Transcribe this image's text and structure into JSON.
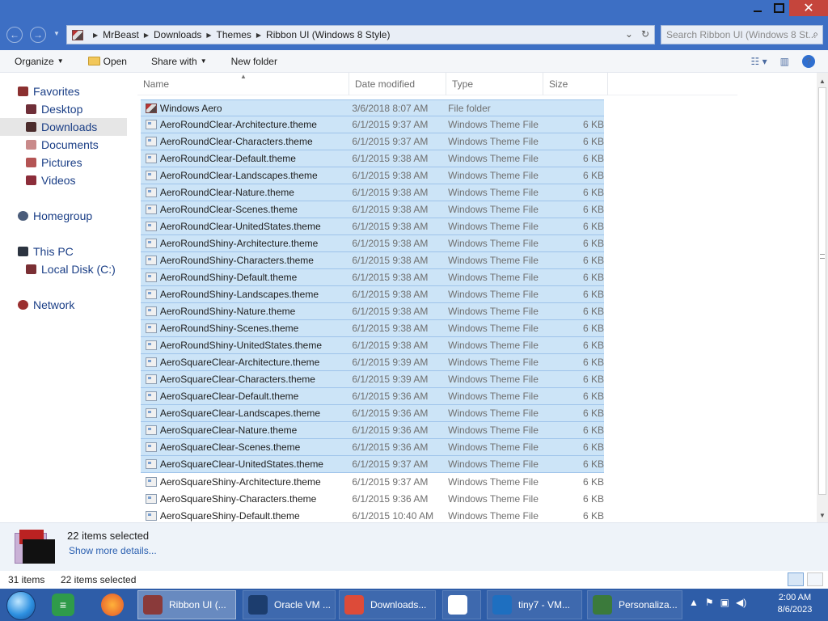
{
  "window": {
    "title_buttons": {
      "minimize": "–",
      "maximize": "❐",
      "close": "✕"
    }
  },
  "address": {
    "crumbs": [
      "MrBeast",
      "Downloads",
      "Themes",
      "Ribbon UI (Windows 8 Style)"
    ],
    "search_placeholder": "Search Ribbon UI (Windows 8 St..."
  },
  "toolbar": {
    "organize": "Organize",
    "open": "Open",
    "share_with": "Share with",
    "new_folder": "New folder",
    "help": "?"
  },
  "nav": {
    "favorites": "Favorites",
    "desktop": "Desktop",
    "downloads": "Downloads",
    "documents": "Documents",
    "pictures": "Pictures",
    "videos": "Videos",
    "homegroup": "Homegroup",
    "this_pc": "This PC",
    "local_disk": "Local Disk (C:)",
    "network": "Network"
  },
  "columns": {
    "name": "Name",
    "date": "Date modified",
    "type": "Type",
    "size": "Size"
  },
  "files": [
    {
      "name": "Windows Aero",
      "date": "3/6/2018 8:07 AM",
      "type": "File folder",
      "size": "",
      "folder": true,
      "selected": true
    },
    {
      "name": "AeroRoundClear-Architecture.theme",
      "date": "6/1/2015 9:37 AM",
      "type": "Windows Theme File",
      "size": "6 KB",
      "selected": true
    },
    {
      "name": "AeroRoundClear-Characters.theme",
      "date": "6/1/2015 9:37 AM",
      "type": "Windows Theme File",
      "size": "6 KB",
      "selected": true
    },
    {
      "name": "AeroRoundClear-Default.theme",
      "date": "6/1/2015 9:38 AM",
      "type": "Windows Theme File",
      "size": "6 KB",
      "selected": true
    },
    {
      "name": "AeroRoundClear-Landscapes.theme",
      "date": "6/1/2015 9:38 AM",
      "type": "Windows Theme File",
      "size": "6 KB",
      "selected": true
    },
    {
      "name": "AeroRoundClear-Nature.theme",
      "date": "6/1/2015 9:38 AM",
      "type": "Windows Theme File",
      "size": "6 KB",
      "selected": true
    },
    {
      "name": "AeroRoundClear-Scenes.theme",
      "date": "6/1/2015 9:38 AM",
      "type": "Windows Theme File",
      "size": "6 KB",
      "selected": true
    },
    {
      "name": "AeroRoundClear-UnitedStates.theme",
      "date": "6/1/2015 9:38 AM",
      "type": "Windows Theme File",
      "size": "6 KB",
      "selected": true
    },
    {
      "name": "AeroRoundShiny-Architecture.theme",
      "date": "6/1/2015 9:38 AM",
      "type": "Windows Theme File",
      "size": "6 KB",
      "selected": true
    },
    {
      "name": "AeroRoundShiny-Characters.theme",
      "date": "6/1/2015 9:38 AM",
      "type": "Windows Theme File",
      "size": "6 KB",
      "selected": true
    },
    {
      "name": "AeroRoundShiny-Default.theme",
      "date": "6/1/2015 9:38 AM",
      "type": "Windows Theme File",
      "size": "6 KB",
      "selected": true
    },
    {
      "name": "AeroRoundShiny-Landscapes.theme",
      "date": "6/1/2015 9:38 AM",
      "type": "Windows Theme File",
      "size": "6 KB",
      "selected": true
    },
    {
      "name": "AeroRoundShiny-Nature.theme",
      "date": "6/1/2015 9:38 AM",
      "type": "Windows Theme File",
      "size": "6 KB",
      "selected": true
    },
    {
      "name": "AeroRoundShiny-Scenes.theme",
      "date": "6/1/2015 9:38 AM",
      "type": "Windows Theme File",
      "size": "6 KB",
      "selected": true
    },
    {
      "name": "AeroRoundShiny-UnitedStates.theme",
      "date": "6/1/2015 9:38 AM",
      "type": "Windows Theme File",
      "size": "6 KB",
      "selected": true
    },
    {
      "name": "AeroSquareClear-Architecture.theme",
      "date": "6/1/2015 9:39 AM",
      "type": "Windows Theme File",
      "size": "6 KB",
      "selected": true
    },
    {
      "name": "AeroSquareClear-Characters.theme",
      "date": "6/1/2015 9:39 AM",
      "type": "Windows Theme File",
      "size": "6 KB",
      "selected": true
    },
    {
      "name": "AeroSquareClear-Default.theme",
      "date": "6/1/2015 9:36 AM",
      "type": "Windows Theme File",
      "size": "6 KB",
      "selected": true
    },
    {
      "name": "AeroSquareClear-Landscapes.theme",
      "date": "6/1/2015 9:36 AM",
      "type": "Windows Theme File",
      "size": "6 KB",
      "selected": true
    },
    {
      "name": "AeroSquareClear-Nature.theme",
      "date": "6/1/2015 9:36 AM",
      "type": "Windows Theme File",
      "size": "6 KB",
      "selected": true
    },
    {
      "name": "AeroSquareClear-Scenes.theme",
      "date": "6/1/2015 9:36 AM",
      "type": "Windows Theme File",
      "size": "6 KB",
      "selected": true
    },
    {
      "name": "AeroSquareClear-UnitedStates.theme",
      "date": "6/1/2015 9:37 AM",
      "type": "Windows Theme File",
      "size": "6 KB",
      "selected": true
    },
    {
      "name": "AeroSquareShiny-Architecture.theme",
      "date": "6/1/2015 9:37 AM",
      "type": "Windows Theme File",
      "size": "6 KB",
      "selected": false
    },
    {
      "name": "AeroSquareShiny-Characters.theme",
      "date": "6/1/2015 9:36 AM",
      "type": "Windows Theme File",
      "size": "6 KB",
      "selected": false
    },
    {
      "name": "AeroSquareShiny-Default.theme",
      "date": "6/1/2015 10:40 AM",
      "type": "Windows Theme File",
      "size": "6 KB",
      "selected": false
    }
  ],
  "details": {
    "title": "22 items selected",
    "link": "Show more details..."
  },
  "status": {
    "count": "31 items",
    "selected": "22 items selected"
  },
  "taskbar": {
    "apps": [
      {
        "label": "Ribbon UI (...",
        "color": "#8a3a3a",
        "active": true
      },
      {
        "label": "Oracle VM ...",
        "color": "#1c3d6e",
        "active": false
      },
      {
        "label": "Downloads...",
        "color": "#dd4b39",
        "active": false
      },
      {
        "label": "",
        "color": "#ffffff",
        "active": false
      },
      {
        "label": "tiny7 - VM...",
        "color": "#1e6fc0",
        "active": false
      },
      {
        "label": "Personaliza...",
        "color": "#3b7a3b",
        "active": false
      }
    ],
    "clock_time": "2:00 AM",
    "clock_date": "8/6/2023"
  },
  "colors": {
    "accent": "#3d6fc4",
    "selection": "#cce4f7",
    "taskbar": "#2e5da8"
  }
}
